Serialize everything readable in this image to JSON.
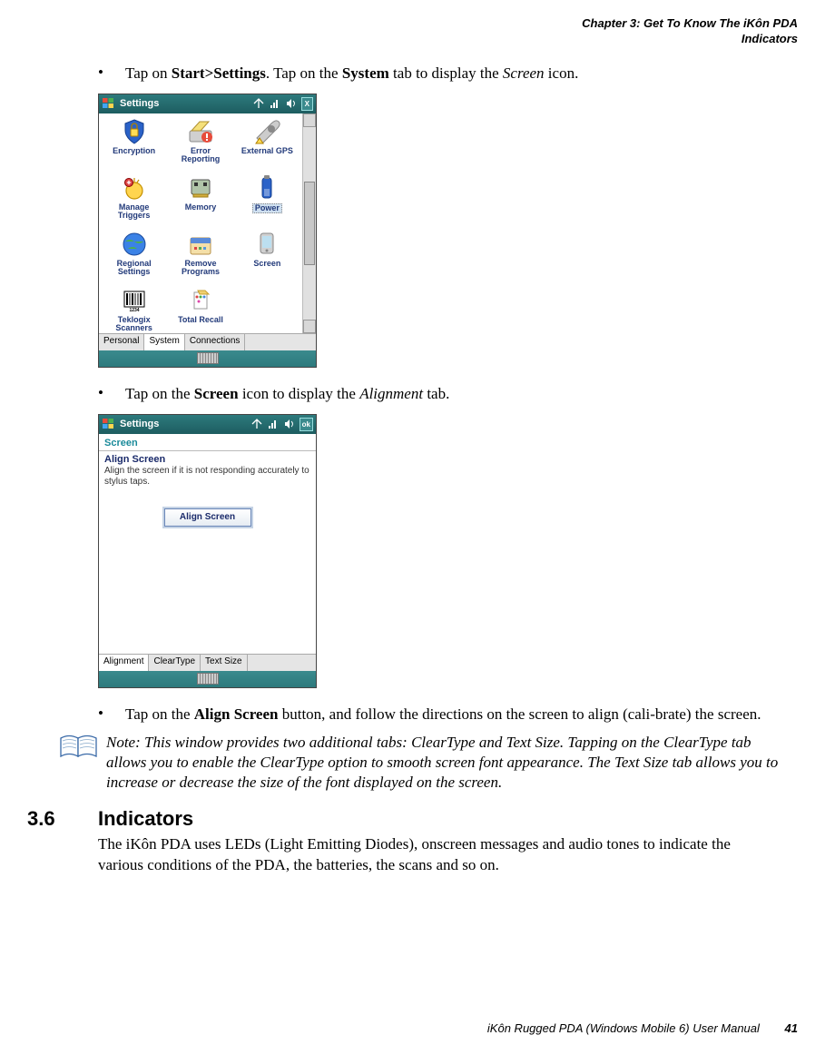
{
  "header": {
    "chapter": "Chapter 3: Get To Know The iKôn PDA",
    "section": "Indicators"
  },
  "bullets": {
    "b1_pre": "Tap on ",
    "b1_b1": "Start>Settings",
    "b1_mid": ". Tap on the ",
    "b1_b2": "System",
    "b1_mid2": " tab to display the ",
    "b1_i": "Screen",
    "b1_end": " icon.",
    "b2_pre": "Tap on the ",
    "b2_b1": "Screen",
    "b2_mid": " icon to display the ",
    "b2_i": "Alignment",
    "b2_end": " tab.",
    "b3_pre": "Tap on the ",
    "b3_b1": "Align Screen",
    "b3_end": " button, and follow the directions on the screen to align (cali-brate) the screen."
  },
  "pda1": {
    "title": "Settings",
    "close": "X",
    "items": [
      {
        "label": "Encryption"
      },
      {
        "label": "Error\nReporting"
      },
      {
        "label": "External GPS"
      },
      {
        "label": "Manage\nTriggers"
      },
      {
        "label": "Memory"
      },
      {
        "label": "Power"
      },
      {
        "label": "Regional\nSettings"
      },
      {
        "label": "Remove\nPrograms"
      },
      {
        "label": "Screen"
      },
      {
        "label": "Teklogix\nScanners"
      },
      {
        "label": "Total Recall"
      }
    ],
    "tabs": [
      "Personal",
      "System",
      "Connections"
    ]
  },
  "pda2": {
    "title": "Settings",
    "ok": "ok",
    "screenLabel": "Screen",
    "alignTitle": "Align Screen",
    "alignDesc": "Align the screen if it is not responding accurately to stylus taps.",
    "alignBtn": "Align Screen",
    "tabs": [
      "Alignment",
      "ClearType",
      "Text Size"
    ]
  },
  "note": {
    "text": "Note: This window provides two additional tabs: ClearType and Text Size. Tapping on the ClearType tab allows you to enable the ClearType option to smooth screen font appearance. The Text Size tab allows you to increase or decrease the size of the font displayed on the screen."
  },
  "section": {
    "num": "3.6",
    "title": "Indicators",
    "body": "The iKôn PDA uses LEDs (Light Emitting Diodes), onscreen messages and audio tones to indicate the various conditions of the PDA, the batteries, the scans and so on."
  },
  "footer": {
    "text": "iKôn Rugged PDA (Windows Mobile 6) User Manual",
    "page": "41"
  }
}
